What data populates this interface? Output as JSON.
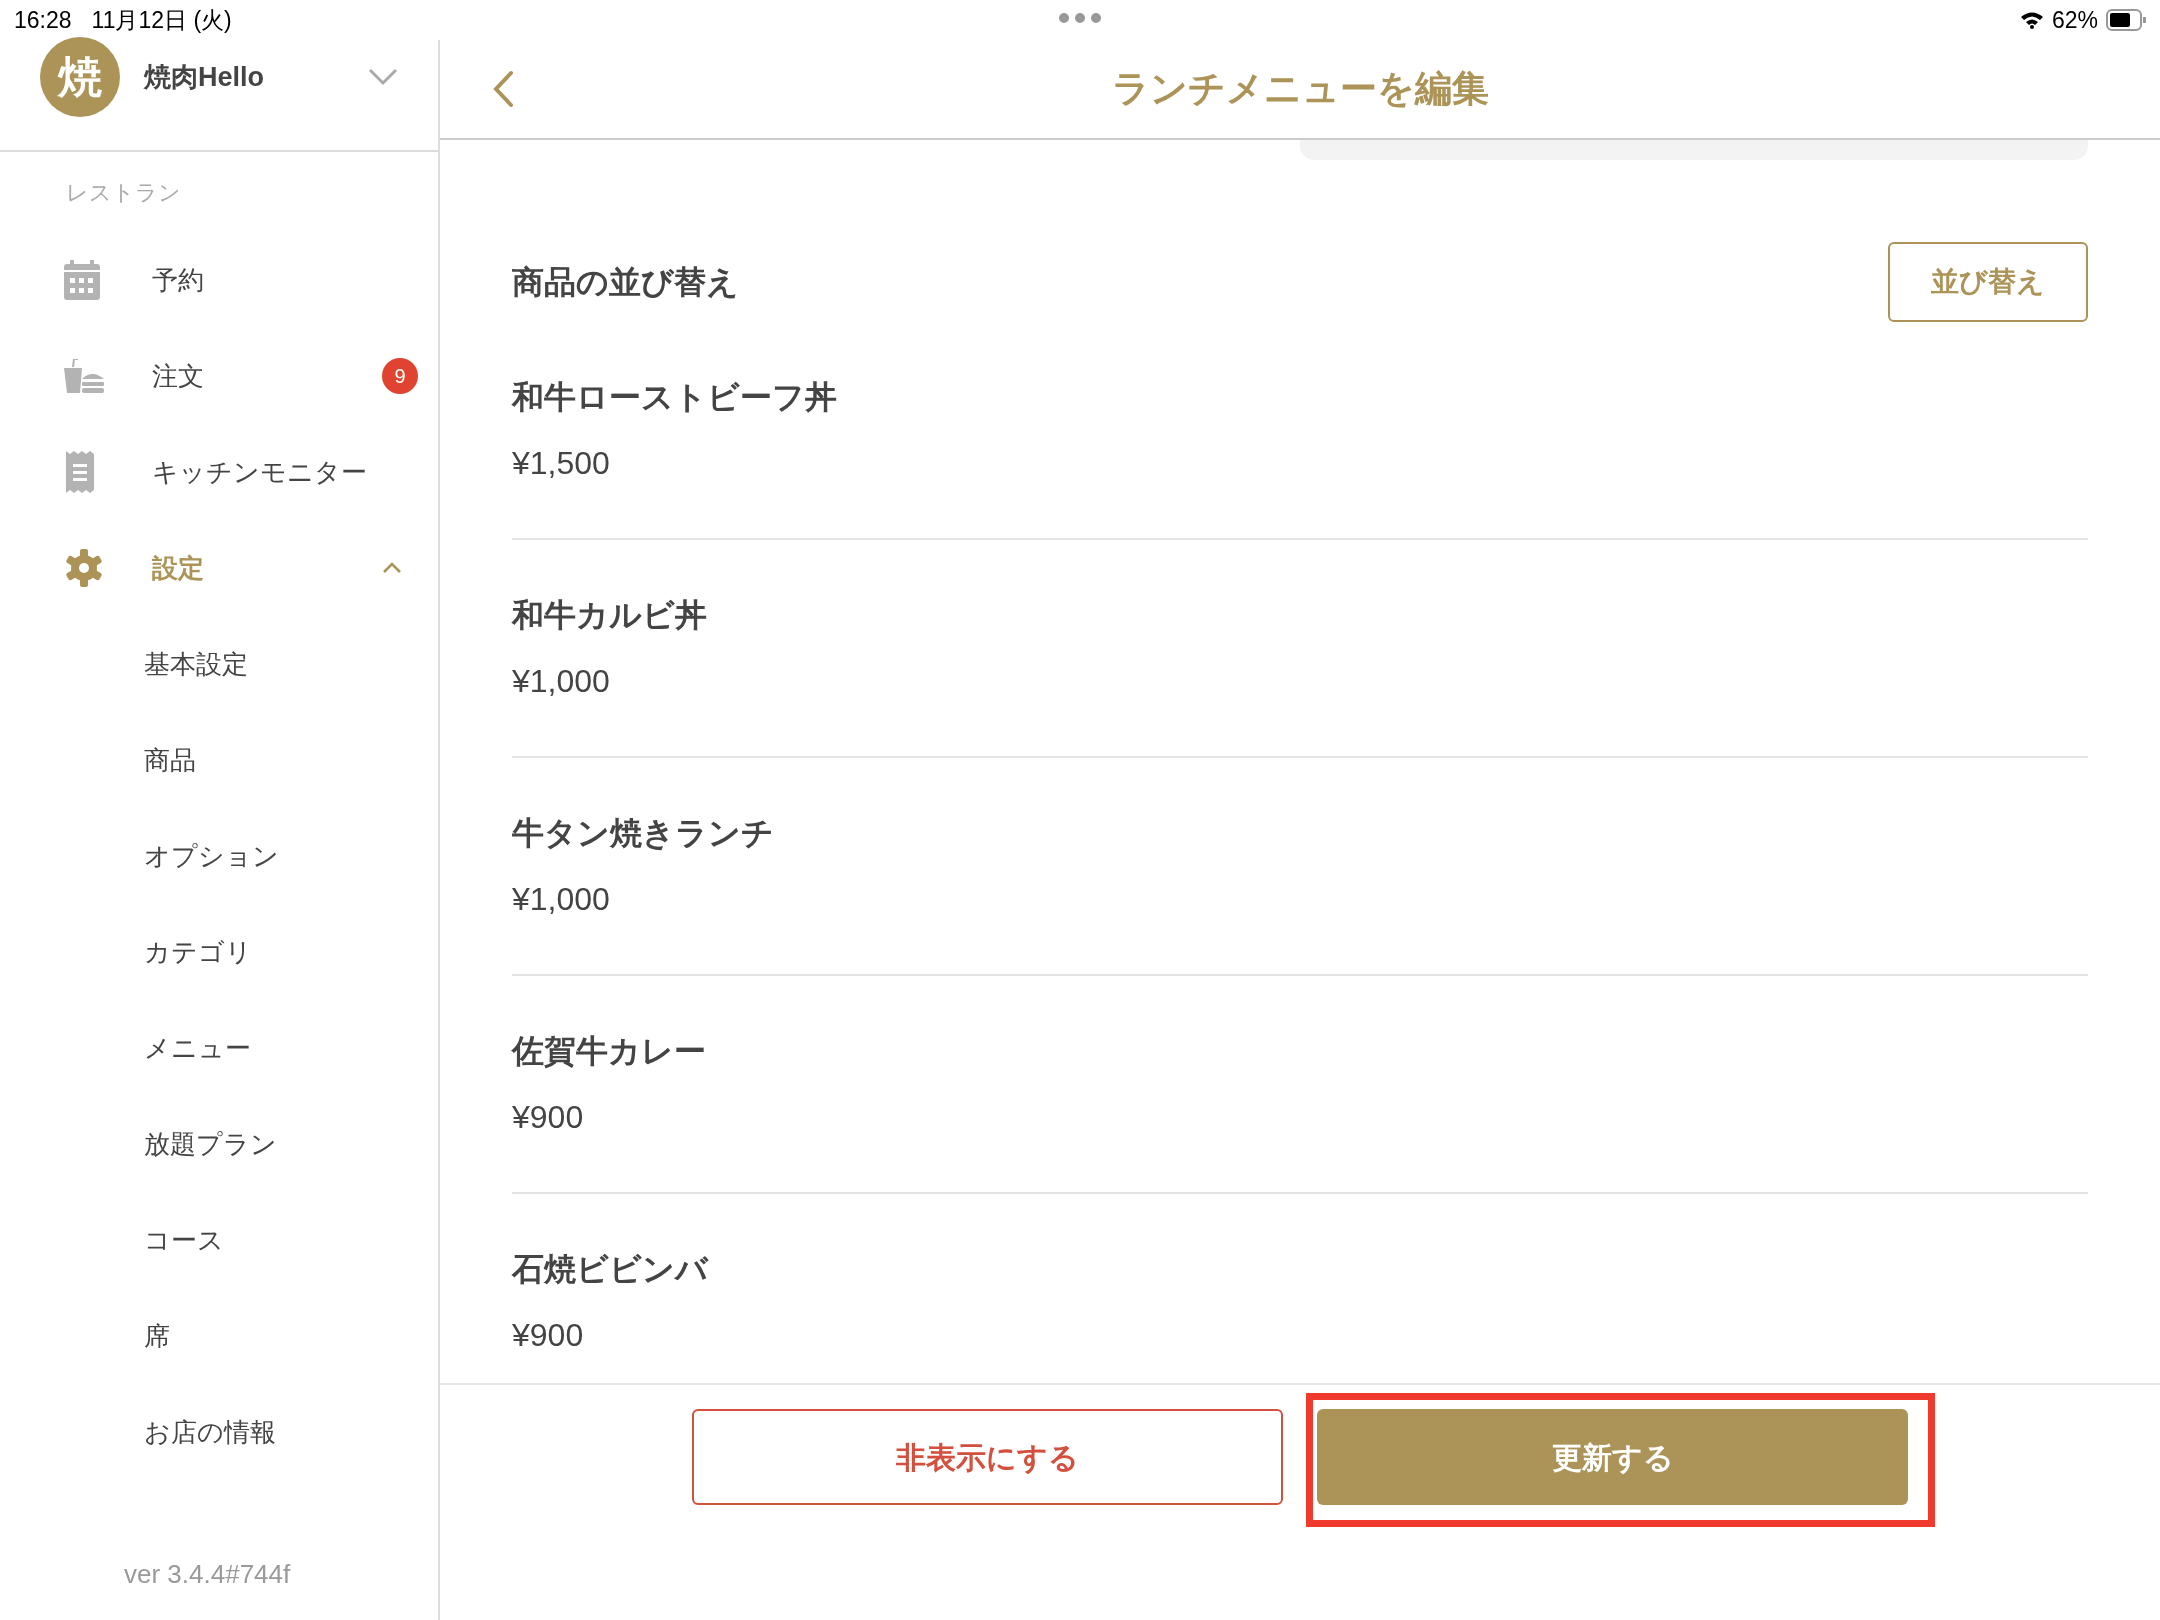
{
  "status_bar": {
    "time": "16:28",
    "date": "11月12日 (火)",
    "battery": "62%"
  },
  "sidebar": {
    "avatar": "焼",
    "store_name": "焼肉Hello",
    "section": "レストラン",
    "items": [
      {
        "label": "予約",
        "kind": "calendar",
        "selected": false
      },
      {
        "label": "注文",
        "kind": "order",
        "badge": "9",
        "selected": false
      },
      {
        "label": "キッチンモニター",
        "kind": "receipt",
        "selected": false
      },
      {
        "label": "設定",
        "kind": "gear",
        "selected": true,
        "expanded": true,
        "children": [
          {
            "label": "基本設定",
            "selected": false
          },
          {
            "label": "商品",
            "selected": false
          },
          {
            "label": "オプション",
            "selected": false
          },
          {
            "label": "カテゴリ",
            "selected": false
          },
          {
            "label": "メニュー",
            "selected": false
          },
          {
            "label": "放題プラン",
            "selected": false
          },
          {
            "label": "コース",
            "selected": false
          },
          {
            "label": "席",
            "selected": false
          },
          {
            "label": "お店の情報",
            "selected": false
          }
        ]
      }
    ],
    "version": "ver 3.4.4#744f"
  },
  "header": {
    "title": "ランチメニューを編集"
  },
  "sort_section": {
    "title": "商品の並び替え",
    "button": "並び替え"
  },
  "products": [
    {
      "name": "和牛ローストビーフ丼",
      "price": "¥1,500"
    },
    {
      "name": "和牛カルビ丼",
      "price": "¥1,000"
    },
    {
      "name": "牛タン焼きランチ",
      "price": "¥1,000"
    },
    {
      "name": "佐賀牛カレー",
      "price": "¥900"
    },
    {
      "name": "石焼ビビンバ",
      "price": "¥900"
    }
  ],
  "actions": [
    {
      "label": "非表示にする",
      "kind": "danger",
      "highlighted": false
    },
    {
      "label": "更新する",
      "kind": "primary",
      "highlighted": true
    }
  ]
}
